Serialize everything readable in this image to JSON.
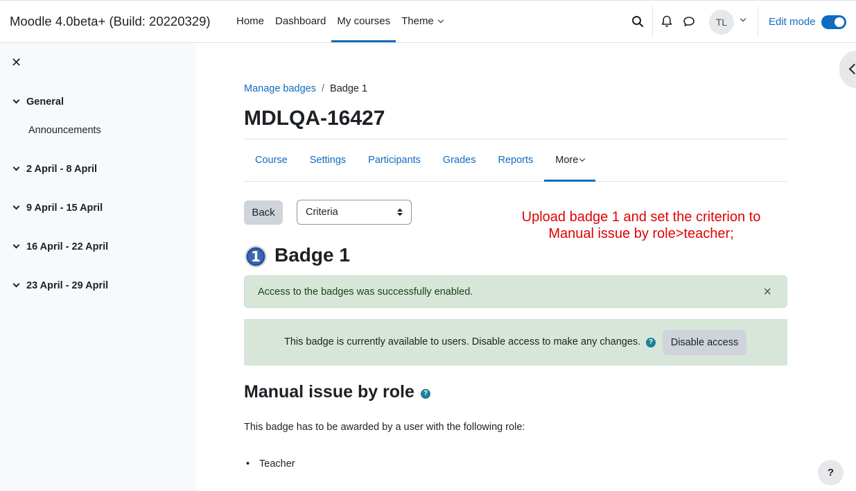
{
  "navbar": {
    "brand": "Moodle 4.0beta+ (Build: 20220329)",
    "links": [
      {
        "label": "Home"
      },
      {
        "label": "Dashboard"
      },
      {
        "label": "My courses"
      },
      {
        "label": "Theme"
      }
    ],
    "active_link": "My courses",
    "user_initials": "TL",
    "edit_mode_label": "Edit mode",
    "edit_mode_on": true,
    "accent_color": "#0f6cbf"
  },
  "drawer": {
    "sections": [
      {
        "label": "General"
      },
      {
        "label": "2 April - 8 April"
      },
      {
        "label": "9 April - 15 April"
      },
      {
        "label": "16 April - 22 April"
      },
      {
        "label": "23 April - 29 April"
      }
    ],
    "activities": [
      "Announcements"
    ]
  },
  "breadcrumb": {
    "items": [
      "Manage badges",
      "Badge 1"
    ],
    "separator": "/"
  },
  "page_title": "MDLQA-16427",
  "secondary_nav": {
    "tabs": [
      "Course",
      "Settings",
      "Participants",
      "Grades",
      "Reports",
      "More"
    ],
    "active_tab": "More"
  },
  "toolbar": {
    "back_label": "Back",
    "select_value": "Criteria"
  },
  "annotation": {
    "line1": "Upload badge 1 and set the criterion to",
    "line2": "Manual issue by role>teacher;",
    "color": "#e00000"
  },
  "badge": {
    "icon_number": "1",
    "title": "Badge 1"
  },
  "alert": {
    "message": "Access to the badges was successfully enabled.",
    "close_glyph": "×"
  },
  "status": {
    "message": "This badge is currently available to users. Disable access to make any changes.",
    "disable_label": "Disable access"
  },
  "criteria": {
    "title": "Manual issue by role",
    "description": "This badge has to be awarded by a user with the following role:",
    "roles": [
      "Teacher"
    ]
  },
  "help_fab_label": "?"
}
